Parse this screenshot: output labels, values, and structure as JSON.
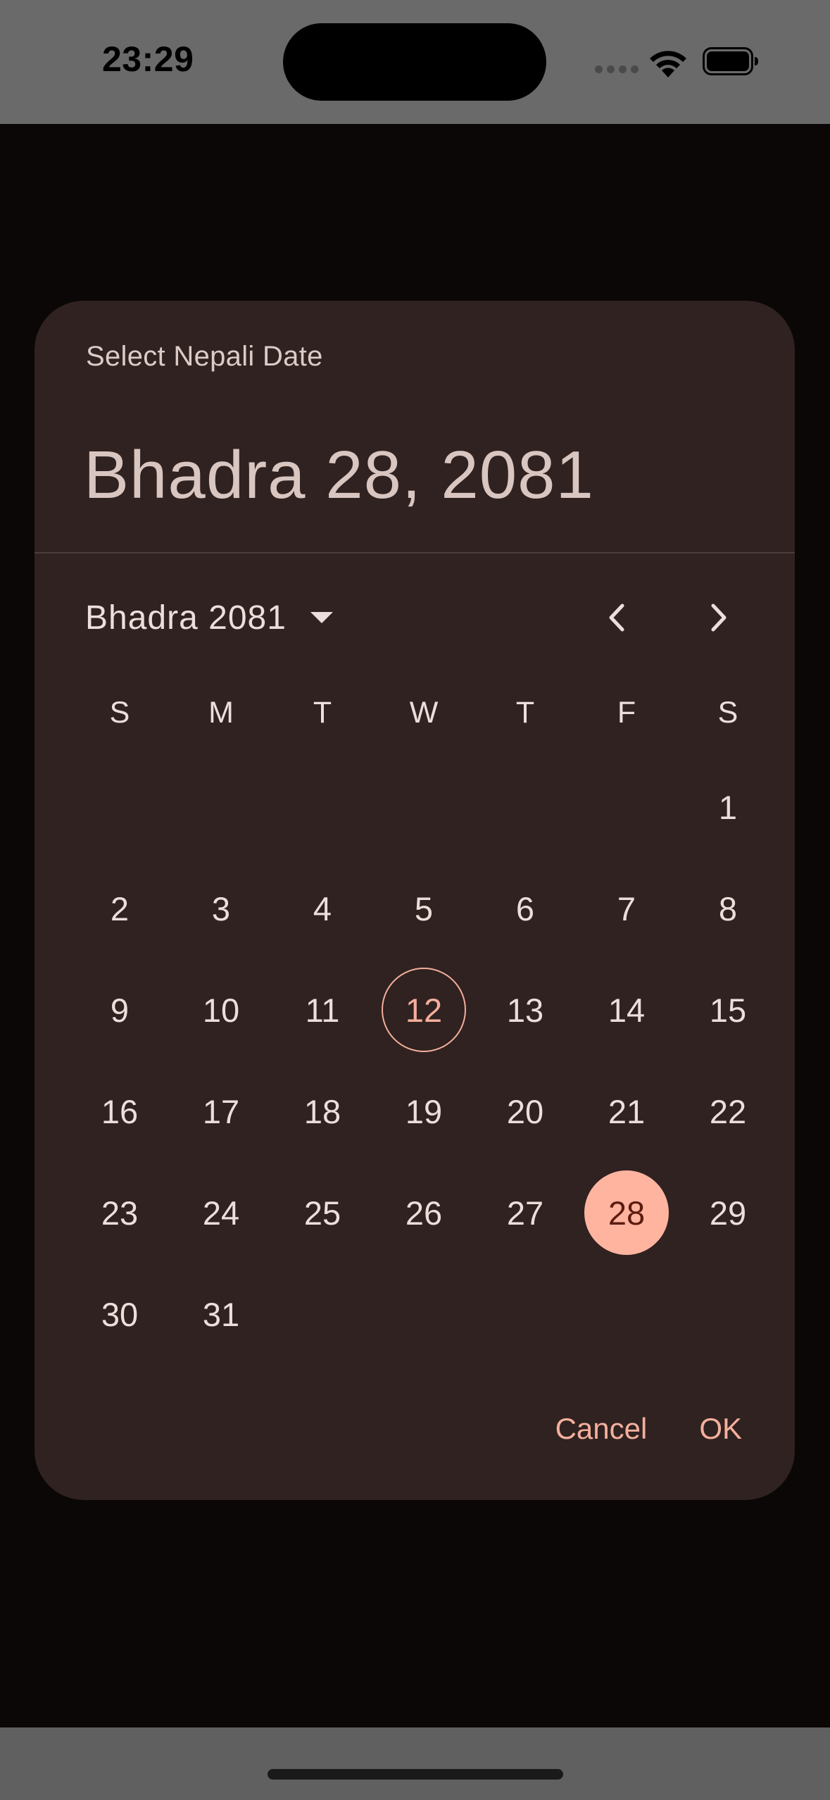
{
  "status_bar": {
    "time": "23:29"
  },
  "dialog": {
    "title": "Select Nepali Date",
    "selected_date_display": "Bhadra 28, 2081",
    "month_year_label": "Bhadra 2081",
    "weekdays": [
      "S",
      "M",
      "T",
      "W",
      "T",
      "F",
      "S"
    ],
    "days": [
      "",
      "",
      "",
      "",
      "",
      "",
      "1",
      "2",
      "3",
      "4",
      "5",
      "6",
      "7",
      "8",
      "9",
      "10",
      "11",
      "12",
      "13",
      "14",
      "15",
      "16",
      "17",
      "18",
      "19",
      "20",
      "21",
      "22",
      "23",
      "24",
      "25",
      "26",
      "27",
      "28",
      "29",
      "30",
      "31"
    ],
    "today": "12",
    "selected_day": "28",
    "cancel_label": "Cancel",
    "ok_label": "OK"
  },
  "icons": {
    "dropdown": "caret-down-icon",
    "prev": "chevron-left-icon",
    "next": "chevron-right-icon",
    "wifi": "wifi-icon",
    "battery": "battery-icon"
  },
  "colors": {
    "dialog_background": "#2f2220",
    "accent": "#ffb4a0",
    "text": "#ecdfdb",
    "scrim": "#0b0706"
  }
}
